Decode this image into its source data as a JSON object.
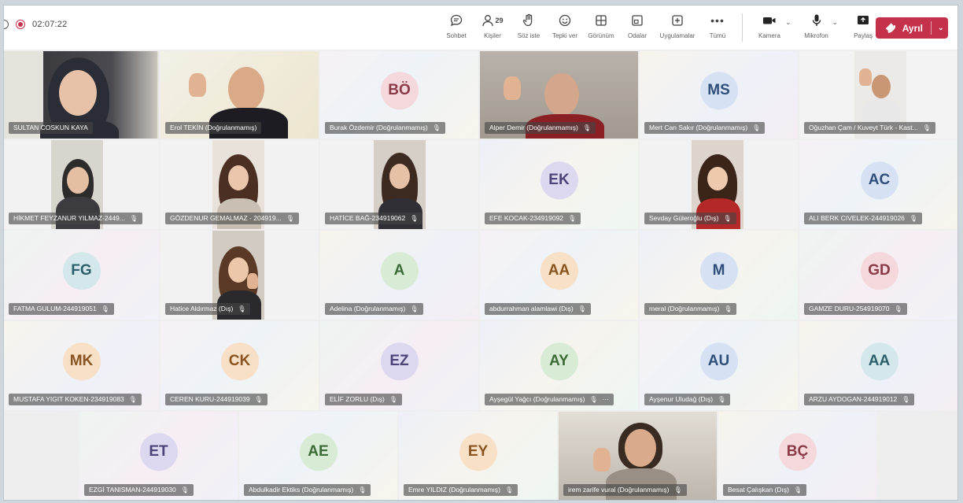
{
  "toolbar": {
    "timer": "02:07:22",
    "participants_count": "29",
    "items": [
      {
        "label": "Sohbet",
        "icon": "chat-icon"
      },
      {
        "label": "Kişiler",
        "icon": "people-icon"
      },
      {
        "label": "Söz iste",
        "icon": "raise-hand-icon"
      },
      {
        "label": "Tepki ver",
        "icon": "reaction-icon"
      },
      {
        "label": "Görünüm",
        "icon": "view-icon"
      },
      {
        "label": "Odalar",
        "icon": "rooms-icon"
      },
      {
        "label": "Uygulamalar",
        "icon": "apps-icon"
      },
      {
        "label": "Tümü",
        "icon": "more-icon"
      }
    ],
    "camera_label": "Kamera",
    "mic_label": "Mikrofon",
    "share_label": "Paylaş",
    "leave_label": "Ayrıl"
  },
  "participants": [
    {
      "name": "SULTAN COSKUN KAYA",
      "type": "video"
    },
    {
      "name": "Erol TEKİN (Doğrulanmamış)",
      "type": "video"
    },
    {
      "name": "Burak Özdemir (Doğrulanmamış)",
      "initials": "BÖ",
      "type": "avatar"
    },
    {
      "name": "Alper Demir (Doğrulanmamış)",
      "type": "video"
    },
    {
      "name": "Mert Can Sakır (Doğrulanmamış)",
      "initials": "MS",
      "type": "avatar"
    },
    {
      "name": "Oğuzhan Çam / Kuveyt Türk - Kast...",
      "type": "video"
    },
    {
      "name": "HİKMET FEYZANUR YILMAZ-2449...",
      "type": "video"
    },
    {
      "name": "GÖZDENUR GEMALMAZ - 204919...",
      "type": "video"
    },
    {
      "name": "HATİCE BAĞ-234919062",
      "type": "video"
    },
    {
      "name": "EFE KOCAK-234919092",
      "initials": "EK",
      "type": "avatar"
    },
    {
      "name": "Sevday Güleroğlu (Dış)",
      "type": "video"
    },
    {
      "name": "ALI BERK CIVELEK-244919026",
      "initials": "AC",
      "type": "avatar"
    },
    {
      "name": "FATMA GULUM-244919051",
      "initials": "FG",
      "type": "avatar"
    },
    {
      "name": "Hatice Aldırmaz (Dış)",
      "type": "video"
    },
    {
      "name": "Adelina (Doğrulanmamış)",
      "initials": "A",
      "type": "avatar"
    },
    {
      "name": "abdurrahman alamlawi (Dış)",
      "initials": "AA",
      "type": "avatar"
    },
    {
      "name": "meral (Doğrulanmamış)",
      "initials": "M",
      "type": "avatar"
    },
    {
      "name": "GAMZE DURU-254919070",
      "initials": "GD",
      "type": "avatar"
    },
    {
      "name": "MUSTAFA YIGIT KOKEN-234919083",
      "initials": "MK",
      "type": "avatar"
    },
    {
      "name": "CEREN KURU-244919039",
      "initials": "CK",
      "type": "avatar"
    },
    {
      "name": "ELİF ZORLU (Dış)",
      "initials": "EZ",
      "type": "avatar"
    },
    {
      "name": "Ayşegül Yağcı (Doğrulanmamış)",
      "initials": "AY",
      "type": "avatar"
    },
    {
      "name": "Ayşenur Uludağ (Dış)",
      "initials": "AU",
      "type": "avatar"
    },
    {
      "name": "ARZU AYDOGAN-244919012",
      "initials": "AA",
      "type": "avatar"
    },
    {
      "name": "EZGİ TANISMAN-244919030",
      "initials": "ET",
      "type": "avatar"
    },
    {
      "name": "Abdulkadir Ektiks (Doğrulanmamış)",
      "initials": "AE",
      "type": "avatar"
    },
    {
      "name": "Emre YILDIZ (Doğrulanmamış)",
      "initials": "EY",
      "type": "avatar"
    },
    {
      "name": "irem zarife vural (Doğrulanmamış)",
      "type": "video"
    },
    {
      "name": "Besat Çalışkan (Dış)",
      "initials": "BÇ",
      "type": "avatar"
    }
  ]
}
